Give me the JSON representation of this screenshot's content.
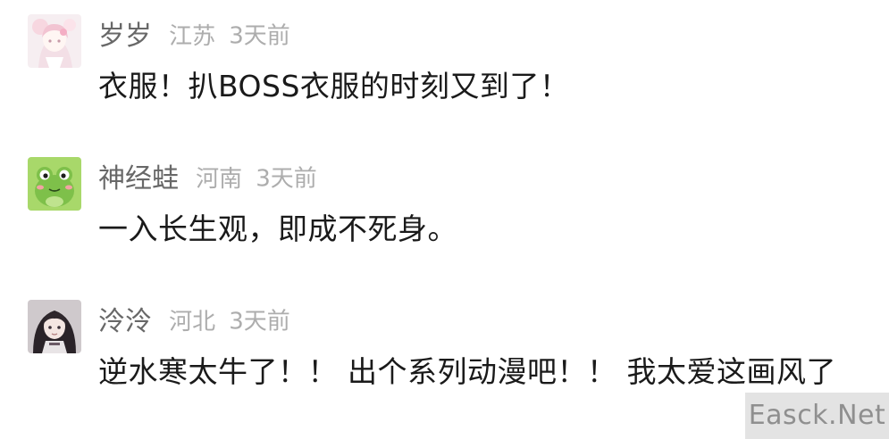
{
  "comments": [
    {
      "username": "岁岁",
      "location": "江苏",
      "time": "3天前",
      "text": "衣服！扒BOSS衣服的时刻又到了！",
      "avatar_icon": "anime-girl-pink-avatar"
    },
    {
      "username": "神经蛙",
      "location": "河南",
      "time": "3天前",
      "text": "一入长生观，即成不死身。",
      "avatar_icon": "green-frog-avatar"
    },
    {
      "username": "泠泠",
      "location": "河北",
      "time": "3天前",
      "text": "逆水寒太牛了！！ 出个系列动漫吧！！ 我太爱这画风了",
      "avatar_icon": "anime-girl-dark-avatar"
    }
  ],
  "watermark": {
    "text": "Easck.Net"
  }
}
